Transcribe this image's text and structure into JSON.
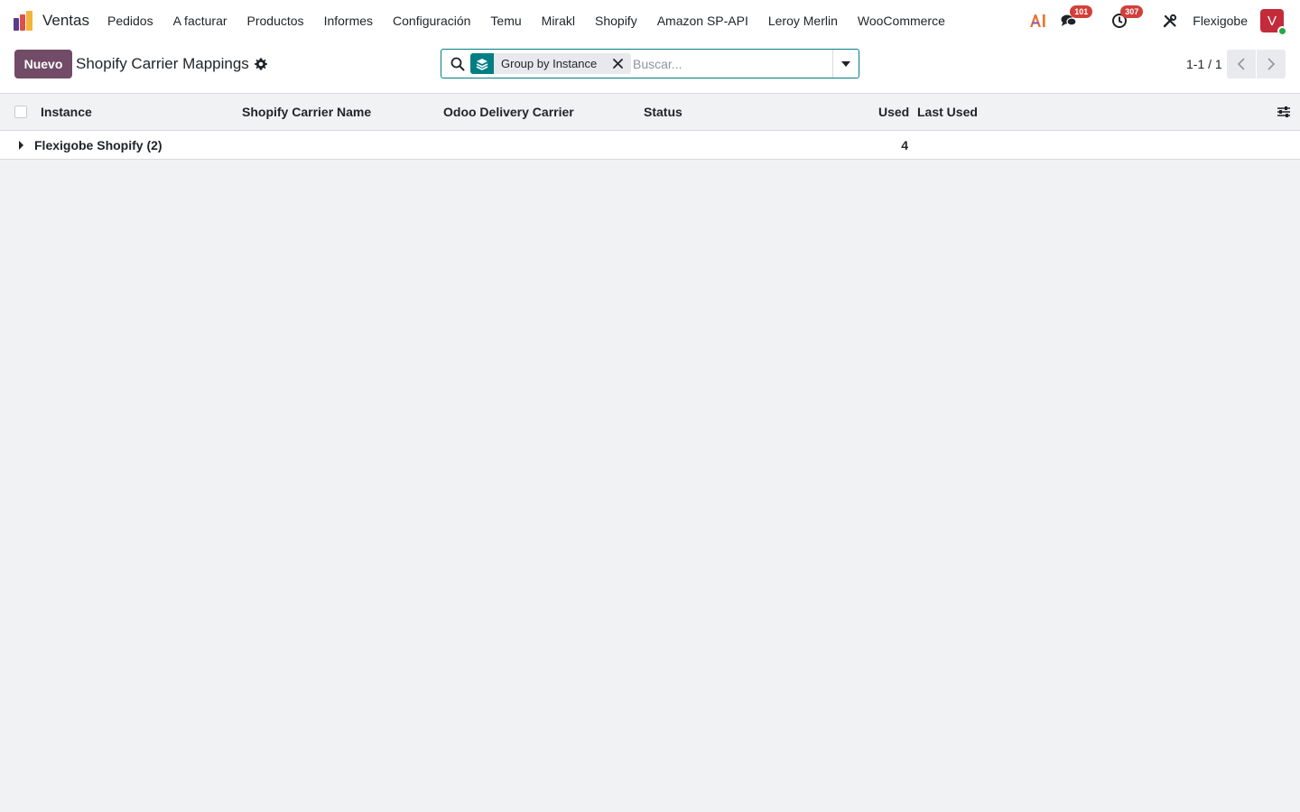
{
  "navbar": {
    "app_name": "Ventas",
    "menu": [
      "Pedidos",
      "A facturar",
      "Productos",
      "Informes",
      "Configuración",
      "Temu",
      "Mirakl",
      "Shopify",
      "Amazon SP-API",
      "Leroy Merlin",
      "WooCommerce"
    ],
    "systray": {
      "ai_label": "AI",
      "messages_count": "101",
      "activities_count": "307",
      "company": "Flexigobe",
      "avatar_initial": "V"
    }
  },
  "control_panel": {
    "new_button": "Nuevo",
    "title": "Shopify Carrier Mappings",
    "search": {
      "facet_label": "Group by Instance",
      "placeholder": "Buscar..."
    },
    "pager": "1-1 / 1"
  },
  "list": {
    "columns": [
      "Instance",
      "Shopify Carrier Name",
      "Odoo Delivery Carrier",
      "Status",
      "Used",
      "Last Used"
    ],
    "groups": [
      {
        "name": "Flexigobe Shopify (2)",
        "used": "4"
      }
    ]
  },
  "colors": {
    "brand": "#714b67",
    "accent": "#017e84",
    "badge": "#d23f3a",
    "avatar": "#c42b3a"
  }
}
